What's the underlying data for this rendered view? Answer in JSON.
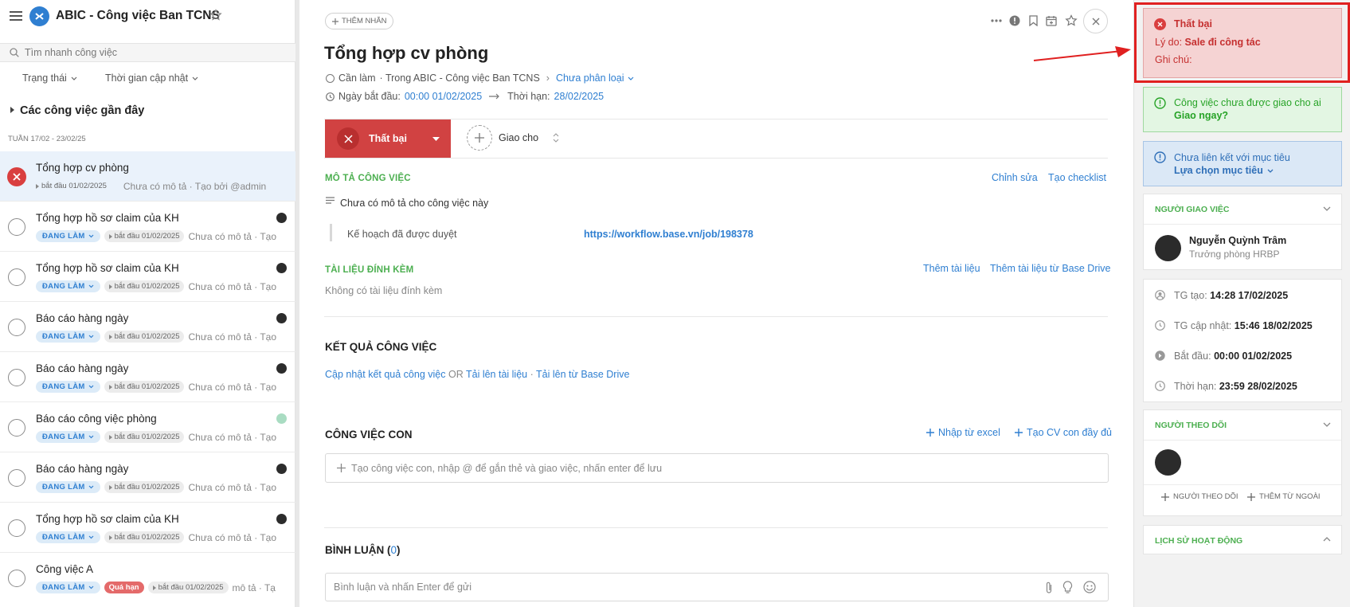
{
  "sidebar": {
    "app_title": "ABIC - Công việc Ban TCNS",
    "search_placeholder": "Tìm nhanh công việc",
    "filter_status": "Trạng thái",
    "filter_time": "Thời gian cập nhật",
    "recent_header": "Các công việc gần đây",
    "week_label": "TUẦN 17/02 - 23/02/25",
    "tasks": [
      {
        "title": "Tổng hợp cv phòng",
        "date": "bắt đầu 01/02/2025",
        "meta": "Chưa có mô tả · Tạo bởi @admin"
      },
      {
        "title": "Tổng hợp hồ sơ claim của KH",
        "status": "ĐANG LÀM",
        "date": "bắt đầu 01/02/2025",
        "meta": "Chưa có mô tả · Tạo"
      },
      {
        "title": "Tổng hợp hồ sơ claim của KH",
        "status": "ĐANG LÀM",
        "date": "bắt đầu 01/02/2025",
        "meta": "Chưa có mô tả · Tạo"
      },
      {
        "title": "Báo cáo hàng ngày",
        "status": "ĐANG LÀM",
        "date": "bắt đầu 01/02/2025",
        "meta": "Chưa có mô tả · Tạo"
      },
      {
        "title": "Báo cáo hàng ngày",
        "status": "ĐANG LÀM",
        "date": "bắt đầu 01/02/2025",
        "meta": "Chưa có mô tả · Tạo"
      },
      {
        "title": "Báo cáo công việc phòng",
        "status": "ĐANG LÀM",
        "date": "bắt đầu 01/02/2025",
        "meta": "Chưa có mô tả · Tạo"
      },
      {
        "title": "Báo cáo hàng ngày",
        "status": "ĐANG LÀM",
        "date": "bắt đầu 01/02/2025",
        "meta": "Chưa có mô tả · Tạo"
      },
      {
        "title": "Tổng hợp hồ sơ claim của KH",
        "status": "ĐANG LÀM",
        "date": "bắt đầu 01/02/2025",
        "meta": "Chưa có mô tả · Tạo"
      },
      {
        "title": "Công việc A",
        "status": "ĐANG LÀM",
        "late": "Quá hạn",
        "date": "bắt đầu 01/02/2025",
        "meta": "mô tả · Tạ"
      }
    ]
  },
  "main": {
    "add_tag": "THÊM NHÃN",
    "title": "Tổng hợp cv phòng",
    "status_text": "Cần làm",
    "project_text": "· Trong ABIC - Công việc Ban TCNS",
    "classify": "Chưa phân loại",
    "start_label": "Ngày bắt đầu:",
    "start_value": "00:00 01/02/2025",
    "due_label": "Thời hạn:",
    "due_value": "28/02/2025",
    "fail_button": "Thất bại",
    "assign_label": "Giao cho",
    "desc_header": "MÔ TẢ CÔNG VIỆC",
    "edit_link": "Chỉnh sửa",
    "checklist_link": "Tạo checklist",
    "no_desc": "Chưa có mô tả cho công việc này",
    "plan_label": "Kế hoạch đã được duyệt",
    "plan_link": "https://workflow.base.vn/job/198378",
    "attach_header": "TÀI LIỆU ĐÍNH KÈM",
    "add_doc": "Thêm tài liệu",
    "add_doc_drive": "Thêm tài liệu từ Base Drive",
    "no_attach": "Không có tài liệu đính kèm",
    "result_header": "KẾT QUẢ CÔNG VIỆC",
    "update_result": "Cập nhật kết quả công việc",
    "or": "OR",
    "upload": "Tải lên tài liệu",
    "upload_drive": "Tải lên từ Base Drive",
    "subtask_header": "CÔNG VIỆC CON",
    "import_excel": "Nhập từ excel",
    "create_full": "Tạo CV con đầy đủ",
    "subtask_placeholder": "Tạo công việc con, nhập @ để gắn thẻ và giao việc, nhấn enter để lưu",
    "comment_header": "BÌNH LUẬN (",
    "comment_count": "0",
    "comment_close": ")",
    "comment_placeholder": "Bình luận và nhấn Enter để gửi"
  },
  "right": {
    "fail_title": "Thất bại",
    "reason_label": "Lý do:",
    "reason_value": "Sale đi công tác",
    "note_label": "Ghi chú:",
    "unassigned_text": "Công việc chưa được giao cho ai",
    "assign_now": "Giao ngay?",
    "no_goal_text": "Chưa liên kết với mục tiêu",
    "choose_goal": "Lựa chọn mục tiêu",
    "assigner_header": "NGƯỜI GIAO VIỆC",
    "assigner_name": "Nguyễn Quỳnh Trâm",
    "assigner_role": "Trưởng phòng HRBP",
    "created_label": "TG tạo:",
    "created_value": "14:28 17/02/2025",
    "updated_label": "TG cập nhật:",
    "updated_value": "15:46 18/02/2025",
    "start_label": "Bắt đầu:",
    "start_value": "00:00 01/02/2025",
    "due_label": "Thời hạn:",
    "due_value": "23:59 28/02/2025",
    "followers_header": "NGƯỜI THEO DÕI",
    "add_follower": "NGƯỜI THEO DÕI",
    "add_external": "THÊM TỪ NGOÀI",
    "history_header": "LỊCH SỬ HOẠT ĐỘNG"
  },
  "colors": {
    "fail": "#d93f3f",
    "link": "#2f7fd1",
    "section": "#4caf50",
    "highlight": "#e02020"
  }
}
